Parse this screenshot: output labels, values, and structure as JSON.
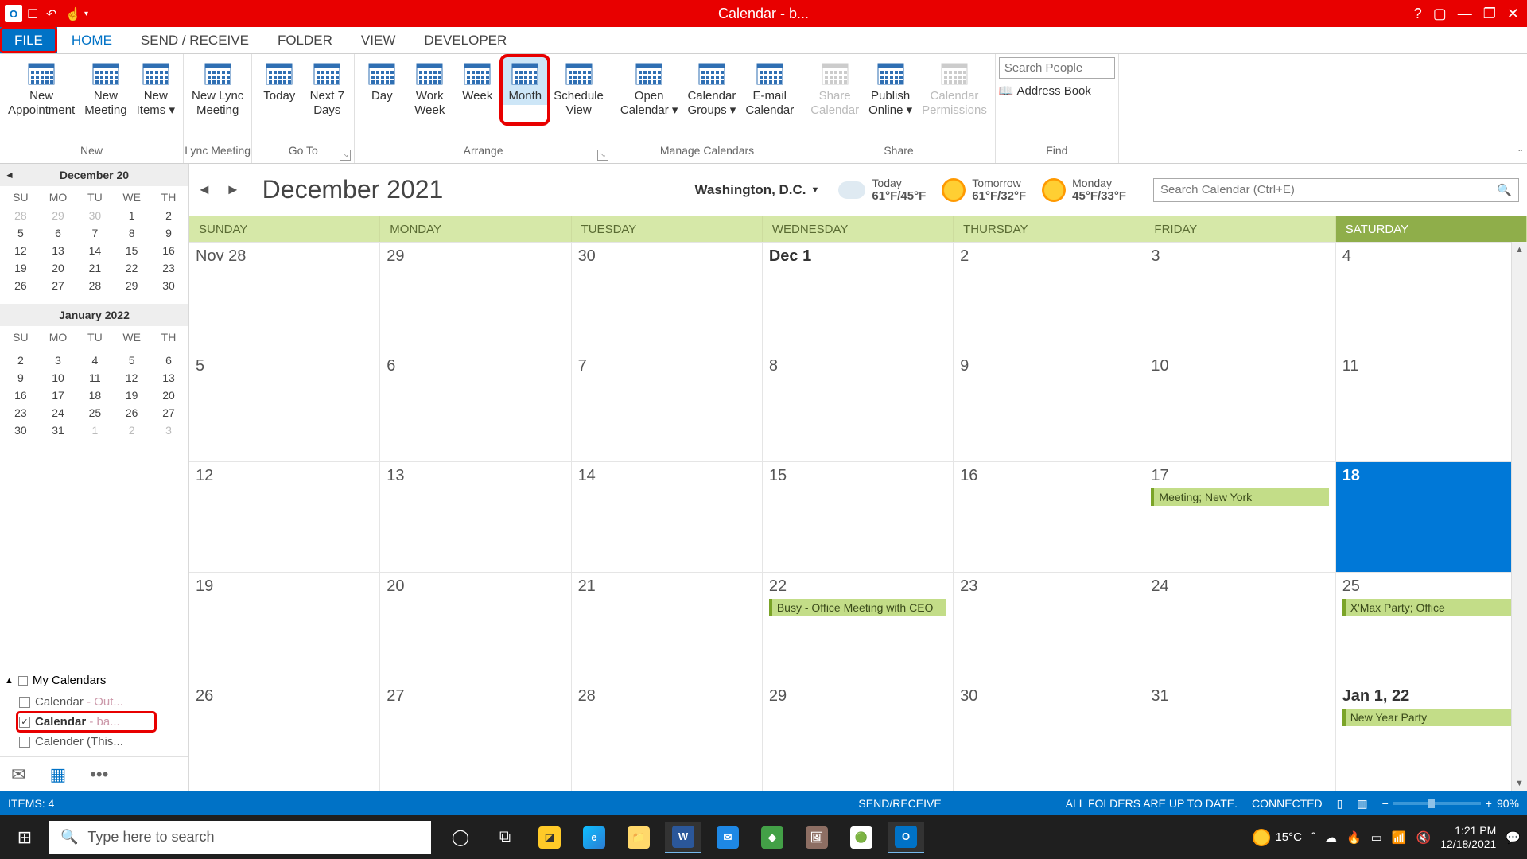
{
  "titlebar": {
    "title": "Calendar - b..."
  },
  "tabs": {
    "file": "FILE",
    "items": [
      "HOME",
      "SEND / RECEIVE",
      "FOLDER",
      "VIEW",
      "DEVELOPER"
    ],
    "active": 0
  },
  "ribbon": {
    "groups": {
      "new": {
        "label": "New",
        "buttons": [
          {
            "t1": "New",
            "t2": "Appointment",
            "icon": "cal"
          },
          {
            "t1": "New",
            "t2": "Meeting",
            "icon": "people"
          },
          {
            "t1": "New",
            "t2": "Items ▾",
            "icon": "items"
          }
        ]
      },
      "lync": {
        "label": "Lync Meeting",
        "buttons": [
          {
            "t1": "New Lync",
            "t2": "Meeting",
            "icon": "lync"
          }
        ]
      },
      "goto": {
        "label": "Go To",
        "buttons": [
          {
            "t1": "Today",
            "icon": "today"
          },
          {
            "t1": "Next 7",
            "t2": "Days",
            "icon": "7days"
          }
        ]
      },
      "arrange": {
        "label": "Arrange",
        "buttons": [
          {
            "t1": "Day"
          },
          {
            "t1": "Work",
            "t2": "Week"
          },
          {
            "t1": "Week"
          },
          {
            "t1": "Month",
            "hi": true
          },
          {
            "t1": "Schedule",
            "t2": "View"
          }
        ]
      },
      "manage": {
        "label": "Manage Calendars",
        "buttons": [
          {
            "t1": "Open",
            "t2": "Calendar ▾"
          },
          {
            "t1": "Calendar",
            "t2": "Groups ▾"
          },
          {
            "t1": "E-mail",
            "t2": "Calendar"
          }
        ]
      },
      "share": {
        "label": "Share",
        "buttons": [
          {
            "t1": "Share",
            "t2": "Calendar",
            "dis": true
          },
          {
            "t1": "Publish",
            "t2": "Online ▾"
          },
          {
            "t1": "Calendar",
            "t2": "Permissions",
            "dis": true
          }
        ]
      },
      "find": {
        "label": "Find",
        "search_ph": "Search People",
        "addr": "Address Book"
      }
    }
  },
  "sidebar": {
    "month1": {
      "title": "December 20",
      "dow": [
        "SU",
        "MO",
        "TU",
        "WE",
        "TH"
      ],
      "rows": [
        [
          "28",
          "29",
          "30",
          "1",
          "2"
        ],
        [
          "5",
          "6",
          "7",
          "8",
          "9"
        ],
        [
          "12",
          "13",
          "14",
          "15",
          "16"
        ],
        [
          "19",
          "20",
          "21",
          "22",
          "23"
        ],
        [
          "26",
          "27",
          "28",
          "29",
          "30"
        ]
      ],
      "dim0": [
        0,
        1,
        2
      ]
    },
    "month2": {
      "title": "January 2022",
      "dow": [
        "SU",
        "MO",
        "TU",
        "WE",
        "TH"
      ],
      "rows": [
        [
          "",
          "",
          "",
          "",
          ""
        ],
        [
          "2",
          "3",
          "4",
          "5",
          "6"
        ],
        [
          "9",
          "10",
          "11",
          "12",
          "13"
        ],
        [
          "16",
          "17",
          "18",
          "19",
          "20"
        ],
        [
          "23",
          "24",
          "25",
          "26",
          "27"
        ],
        [
          "30",
          "31",
          "1",
          "2",
          "3"
        ]
      ],
      "dim5": [
        2,
        3,
        4
      ]
    },
    "mycals": {
      "title": "My Calendars",
      "items": [
        {
          "label": "Calendar",
          "suffix": " - Out...",
          "checked": false
        },
        {
          "label": "Calendar",
          "suffix": " - ba...",
          "checked": true,
          "annot": true,
          "bold": true
        },
        {
          "label": "Calender (This...",
          "checked": false
        }
      ]
    }
  },
  "calendar": {
    "title": "December 2021",
    "location": "Washington,  D.C.",
    "weather": [
      {
        "name": "Today",
        "temp": "61°F/45°F",
        "icon": "cloud"
      },
      {
        "name": "Tomorrow",
        "temp": "61°F/32°F",
        "icon": "sun"
      },
      {
        "name": "Monday",
        "temp": "45°F/33°F",
        "icon": "sun"
      }
    ],
    "search_ph": "Search Calendar (Ctrl+E)",
    "dow": [
      "SUNDAY",
      "MONDAY",
      "TUESDAY",
      "WEDNESDAY",
      "THURSDAY",
      "FRIDAY",
      "SATURDAY"
    ],
    "weeks": [
      [
        {
          "n": "Nov 28"
        },
        {
          "n": "29"
        },
        {
          "n": "30"
        },
        {
          "n": "Dec 1",
          "b": true
        },
        {
          "n": "2"
        },
        {
          "n": "3"
        },
        {
          "n": "4"
        }
      ],
      [
        {
          "n": "5"
        },
        {
          "n": "6"
        },
        {
          "n": "7"
        },
        {
          "n": "8"
        },
        {
          "n": "9"
        },
        {
          "n": "10"
        },
        {
          "n": "11"
        }
      ],
      [
        {
          "n": "12"
        },
        {
          "n": "13"
        },
        {
          "n": "14"
        },
        {
          "n": "15"
        },
        {
          "n": "16"
        },
        {
          "n": "17",
          "e": "Meeting; New York"
        },
        {
          "n": "18",
          "today": true
        }
      ],
      [
        {
          "n": "19"
        },
        {
          "n": "20"
        },
        {
          "n": "21"
        },
        {
          "n": "22",
          "e": "Busy - Office Meeting with CEO"
        },
        {
          "n": "23"
        },
        {
          "n": "24"
        },
        {
          "n": "25",
          "e": "X'Max Party; Office"
        }
      ],
      [
        {
          "n": "26"
        },
        {
          "n": "27"
        },
        {
          "n": "28"
        },
        {
          "n": "29"
        },
        {
          "n": "30"
        },
        {
          "n": "31"
        },
        {
          "n": "Jan 1, 22",
          "b": true,
          "e": "New Year Party"
        }
      ]
    ]
  },
  "status": {
    "items": "ITEMS: 4",
    "sr": "SEND/RECEIVE",
    "fold": "ALL FOLDERS ARE UP TO DATE.",
    "conn": "CONNECTED",
    "zoom": "90%"
  },
  "taskbar": {
    "search_ph": "Type here to search",
    "weather": "15°C",
    "time": "1:21 PM",
    "date": "12/18/2021"
  }
}
